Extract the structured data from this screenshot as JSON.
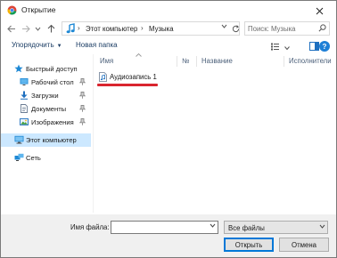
{
  "window": {
    "title": "Открытие",
    "icon": "chrome-icon",
    "close_icon": "close-icon"
  },
  "address": {
    "back_icon": "arrow-left-icon",
    "forward_icon": "arrow-right-icon",
    "history_icon": "chevron-down-icon",
    "up_icon": "arrow-up-icon",
    "location_icon": "music-folder-icon",
    "crumbs": [
      "Этот компьютер",
      "Музыка"
    ],
    "sep": "›",
    "refresh_icon": "refresh-icon"
  },
  "search": {
    "placeholder": "Поиск: Музыка",
    "icon": "search-icon"
  },
  "toolbar": {
    "organize_label": "Упорядочить",
    "new_folder_label": "Новая папка",
    "dd_glyph": "▼",
    "help_glyph": "?"
  },
  "nav": {
    "items": [
      {
        "label": "Быстрый доступ",
        "icon": "star-icon",
        "pinned": false,
        "selected": false
      },
      {
        "label": "Рабочий стол",
        "icon": "desktop-icon",
        "pinned": true,
        "selected": false
      },
      {
        "label": "Загрузки",
        "icon": "download-icon",
        "pinned": true,
        "selected": false
      },
      {
        "label": "Документы",
        "icon": "documents-icon",
        "pinned": true,
        "selected": false
      },
      {
        "label": "Изображения",
        "icon": "pictures-icon",
        "pinned": true,
        "selected": false
      },
      {
        "label": "Этот компьютер",
        "icon": "computer-icon",
        "pinned": false,
        "selected": true
      },
      {
        "label": "Сеть",
        "icon": "network-icon",
        "pinned": false,
        "selected": false
      }
    ]
  },
  "columns": [
    {
      "label": "Имя"
    },
    {
      "label": "№"
    },
    {
      "label": "Название"
    },
    {
      "label": "Исполнители"
    }
  ],
  "files": [
    {
      "name": "Аудиозапись 1",
      "icon": "audio-file-icon"
    }
  ],
  "bottom": {
    "filename_label": "Имя файла:",
    "filename_value": "",
    "filetype_value": "Все файлы",
    "open_label": "Открыть",
    "cancel_label": "Отмена"
  },
  "colors": {
    "accent": "#0078d7",
    "selected_bg": "#cce8ff",
    "underline": "#d9252f"
  }
}
